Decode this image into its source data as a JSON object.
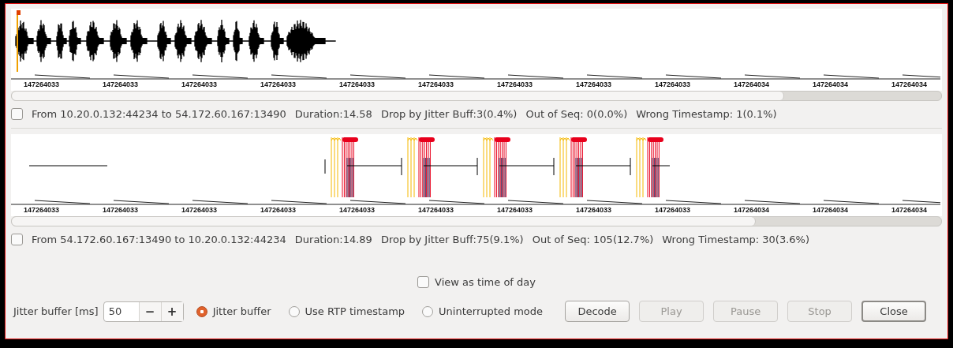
{
  "streams": [
    {
      "checked": false,
      "description": "From 10.20.0.132:44234 to 54.172.60.167:13490",
      "stats": [
        "Duration:14.58",
        "Drop by Jitter Buff:3(0.4%)",
        "Out of Seq: 0(0.0%)",
        "Wrong Timestamp: 1(0.1%)"
      ],
      "kind": "audio",
      "ticks": [
        "147264033",
        "147264033",
        "147264033",
        "147264033",
        "147264033",
        "147264033",
        "147264033",
        "147264033",
        "147264033",
        "147264034",
        "147264034",
        "147264034"
      ]
    },
    {
      "checked": false,
      "description": "From 54.172.60.167:13490 to 10.20.0.132:44234",
      "stats": [
        "Duration:14.89",
        "Drop by Jitter Buff:75(9.1%)",
        "Out of Seq: 105(12.7%)",
        "Wrong Timestamp: 30(3.6%)"
      ],
      "kind": "gaps",
      "ticks": [
        "147264033",
        "147264033",
        "147264033",
        "147264033",
        "147264033",
        "147264033",
        "147264033",
        "147264033",
        "147264033",
        "147264034",
        "147264034",
        "147264034"
      ]
    }
  ],
  "view_as_time_of_day": {
    "label": "View as time of day",
    "checked": false
  },
  "jitter_buffer": {
    "label": "Jitter buffer [ms]",
    "value": "50",
    "decrement": "−",
    "increment": "+"
  },
  "modes": [
    {
      "label": "Jitter buffer",
      "selected": true
    },
    {
      "label": "Use RTP timestamp",
      "selected": false
    },
    {
      "label": "Uninterrupted mode",
      "selected": false
    }
  ],
  "buttons": [
    {
      "label": "Decode",
      "disabled": false,
      "default": false
    },
    {
      "label": "Play",
      "disabled": true,
      "default": false
    },
    {
      "label": "Pause",
      "disabled": true,
      "default": false
    },
    {
      "label": "Stop",
      "disabled": true,
      "default": false
    },
    {
      "label": "Close",
      "disabled": false,
      "default": true
    }
  ]
}
